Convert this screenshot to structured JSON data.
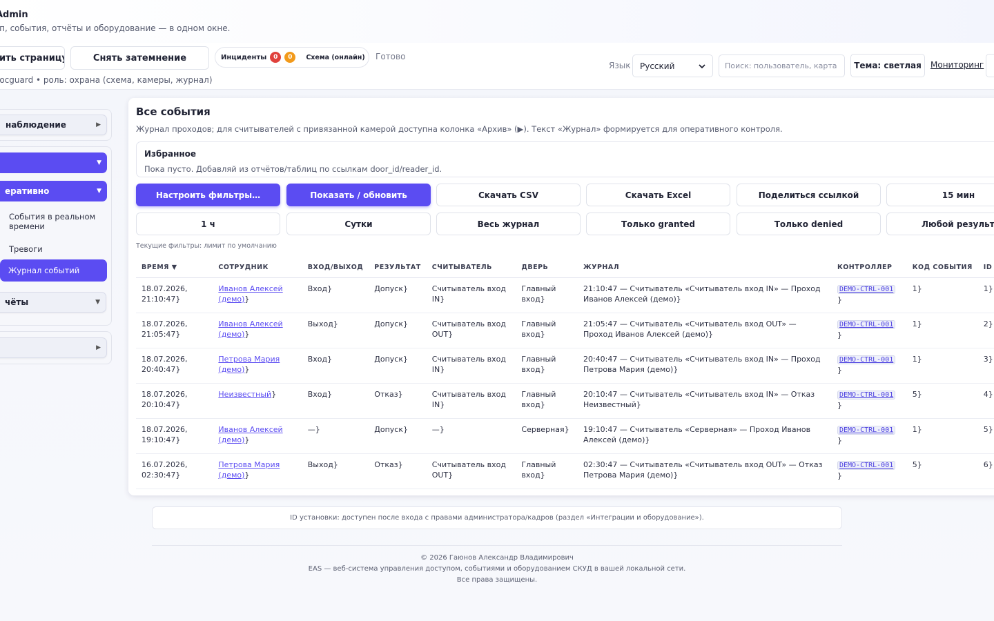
{
  "app": {
    "title": "Admin",
    "subtitle": "уп, события, отчёты и оборудование — в одном окне."
  },
  "toolbar": {
    "refresh_label": "ить страницу",
    "dim_label": "Снять затемнение",
    "incidents_label": "Инциденты",
    "incidents_red_count": "0",
    "incidents_orange_count": "0",
    "scheme_label": "Схема (онлайн)",
    "status": "Готово",
    "lang_label": "Язык",
    "lang_value": "Русский",
    "search_placeholder": "Поиск: пользователь, карта",
    "theme_label": "Тема: светлая",
    "monitoring_label": "Мониторинг",
    "user_line": "locguard • роль: охрана (схема, камеры, журнал)"
  },
  "sidebar": {
    "group1_item": "наблюдение",
    "group2_item_blank": "",
    "group2_item_oper": "еративно",
    "sub_realtime": "События в реальном времени",
    "sub_alarms": "Тревоги",
    "sub_journal": "Журнал событий",
    "group2_reports": "чёты",
    "group3_item_blank": "",
    "arrow_right": "▶",
    "arrow_down": "▼"
  },
  "panel": {
    "title": "Все события",
    "description": "Журнал проходов; для считывателей с привязанной камерой доступна колонка «Архив» (▶). Текст «Журнал» формируется для оперативного контроля.",
    "favorites_title": "Избранное",
    "favorites_text": "Пока пусто. Добавляй из отчётов/таблиц по ссылкам door_id/reader_id.",
    "buttons_row1": [
      "Настроить фильтры…",
      "Показать / обновить",
      "Скачать CSV",
      "Скачать Excel",
      "Поделиться ссылкой",
      "15 мин"
    ],
    "buttons_row2": [
      "1 ч",
      "Сутки",
      "Весь журнал",
      "Только granted",
      "Только denied",
      "Любой результат"
    ],
    "current_filters": "Текущие фильтры: лимит по умолчанию"
  },
  "table": {
    "headers": [
      "ВРЕМЯ ▼",
      "СОТРУДНИК",
      "ВХОД/ВЫХОД",
      "РЕЗУЛЬТАТ",
      "СЧИТЫВАТЕЛЬ",
      "ДВЕРЬ",
      "ЖУРНАЛ",
      "КОНТРОЛЛЕР",
      "КОД СОБЫТИЯ",
      "ID"
    ],
    "rows": [
      {
        "time": "18.07.2026, 21:10:47}",
        "employee": "Иванов Алексей (демо)",
        "emp_suffix": "}",
        "dir": "Вход}",
        "result": "Допуск}",
        "reader": "Считыватель вход IN}",
        "door": "Главный вход}",
        "journal": "21:10:47 — Считыватель «Считыватель вход IN» — Проход Иванов Алексей (демо)}",
        "controller": "DEMO-CTRL-001",
        "ctrl_suffix": " }",
        "code": "1}",
        "id": "1}"
      },
      {
        "time": "18.07.2026, 21:05:47}",
        "employee": "Иванов Алексей (демо)",
        "emp_suffix": "}",
        "dir": "Выход}",
        "result": "Допуск}",
        "reader": "Считыватель вход OUT}",
        "door": "Главный вход}",
        "journal": "21:05:47 — Считыватель «Считыватель вход OUT» — Проход Иванов Алексей (демо)}",
        "controller": "DEMO-CTRL-001",
        "ctrl_suffix": " }",
        "code": "1}",
        "id": "2}"
      },
      {
        "time": "18.07.2026, 20:40:47}",
        "employee": "Петрова Мария (демо)",
        "emp_suffix": "}",
        "dir": "Вход}",
        "result": "Допуск}",
        "reader": "Считыватель вход IN}",
        "door": "Главный вход}",
        "journal": "20:40:47 — Считыватель «Считыватель вход IN» — Проход Петрова Мария (демо)}",
        "controller": "DEMO-CTRL-001",
        "ctrl_suffix": " }",
        "code": "1}",
        "id": "3}"
      },
      {
        "time": "18.07.2026, 20:10:47}",
        "employee": "Неизвестный",
        "emp_suffix": "}",
        "dir": "Вход}",
        "result": "Отказ}",
        "reader": "Считыватель вход IN}",
        "door": "Главный вход}",
        "journal": "20:10:47 — Считыватель «Считыватель вход IN» — Отказ Неизвестный}",
        "controller": "DEMO-CTRL-001",
        "ctrl_suffix": " }",
        "code": "5}",
        "id": "4}"
      },
      {
        "time": "18.07.2026, 19:10:47}",
        "employee": "Иванов Алексей (демо)",
        "emp_suffix": "}",
        "dir": "—}",
        "result": "Допуск}",
        "reader": "—}",
        "door": "Серверная}",
        "journal": "19:10:47 — Считыватель «Серверная» — Проход Иванов Алексей (демо)}",
        "controller": "DEMO-CTRL-001",
        "ctrl_suffix": " }",
        "code": "1}",
        "id": "5}"
      },
      {
        "time": "16.07.2026, 02:30:47}",
        "employee": "Петрова Мария (демо)",
        "emp_suffix": "}",
        "dir": "Выход}",
        "result": "Отказ}",
        "reader": "Считыватель вход OUT}",
        "door": "Главный вход}",
        "journal": "02:30:47 — Считыватель «Считыватель вход OUT» — Отказ Петрова Мария (демо)}",
        "controller": "DEMO-CTRL-001",
        "ctrl_suffix": " }",
        "code": "5}",
        "id": "6}"
      }
    ]
  },
  "footer": {
    "install_id": "ID установки: доступен после входа с правами администратора/кадров (раздел «Интеграции и оборудование»).",
    "copyright": "© 2026 Гаюнов Александр Владимирович",
    "about": "EAS — веб-система управления доступом, событиями и оборудованием СКУД в вашей локальной сети.",
    "rights": "Все права защищены."
  },
  "colors": {
    "accent": "#5b4cf2",
    "badge_red": "#e0413c",
    "badge_orange": "#f29a1b"
  }
}
